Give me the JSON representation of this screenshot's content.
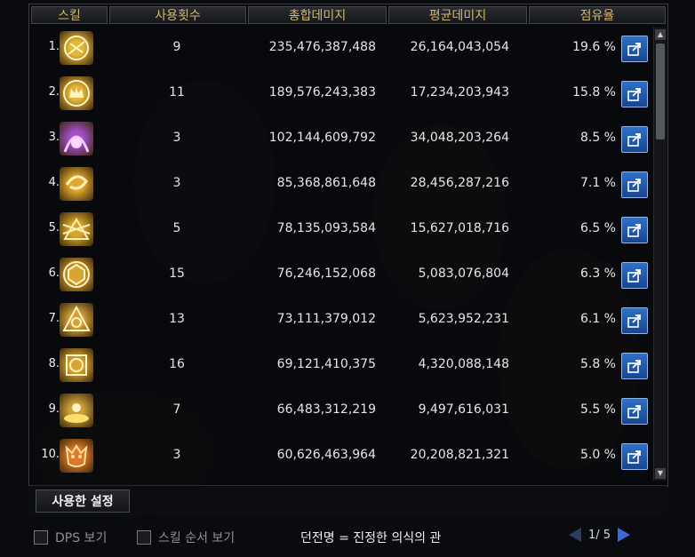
{
  "header": {
    "skill": "스킬",
    "uses": "사용횟수",
    "total": "총합데미지",
    "average": "평균데미지",
    "share": "점유율"
  },
  "rows": [
    {
      "rank": "1.",
      "icon": "skill-icon-rune-circle",
      "uses": "9",
      "total": "235,476,387,488",
      "average": "26,164,043,054",
      "share": "19.6 %",
      "color": "#e2b83a"
    },
    {
      "rank": "2.",
      "icon": "skill-icon-crown",
      "uses": "11",
      "total": "189,576,243,383",
      "average": "17,234,203,943",
      "share": "15.8 %",
      "color": "#e3b23a"
    },
    {
      "rank": "3.",
      "icon": "skill-icon-purple-aura",
      "uses": "3",
      "total": "102,144,609,792",
      "average": "34,048,203,264",
      "share": "8.5 %",
      "color": "#a24fc7"
    },
    {
      "rank": "4.",
      "icon": "skill-icon-swirl",
      "uses": "3",
      "total": "85,368,861,648",
      "average": "28,456,287,216",
      "share": "7.1 %",
      "color": "#e0a82e"
    },
    {
      "rank": "5.",
      "icon": "skill-icon-burst",
      "uses": "5",
      "total": "78,135,093,584",
      "average": "15,627,018,716",
      "share": "6.5 %",
      "color": "#d6a529"
    },
    {
      "rank": "6.",
      "icon": "skill-icon-hex-rune",
      "uses": "15",
      "total": "76,246,152,068",
      "average": "5,083,076,804",
      "share": "6.3 %",
      "color": "#d9a431"
    },
    {
      "rank": "7.",
      "icon": "skill-icon-triangle-rune",
      "uses": "13",
      "total": "73,111,379,012",
      "average": "5,623,952,231",
      "share": "6.1 %",
      "color": "#d4a23a"
    },
    {
      "rank": "8.",
      "icon": "skill-icon-square-rune",
      "uses": "16",
      "total": "69,121,410,375",
      "average": "4,320,088,148",
      "share": "5.8 %",
      "color": "#d8a434"
    },
    {
      "rank": "9.",
      "icon": "skill-icon-gold-pile",
      "uses": "7",
      "total": "66,483,312,219",
      "average": "9,497,616,031",
      "share": "5.5 %",
      "color": "#caa03a"
    },
    {
      "rank": "10.",
      "icon": "skill-icon-demon-face",
      "uses": "3",
      "total": "60,626,463,964",
      "average": "20,208,821,321",
      "share": "5.0 %",
      "color": "#e07a2a"
    }
  ],
  "tab": "사용한 설정",
  "bottom": {
    "dps_label": "DPS 보기",
    "order_label": "스킬 순서 보기",
    "dungeon": "던전명 = 진정한 의식의 관",
    "page": "1/ 5"
  },
  "colors": {
    "header_text": "#d2b66a",
    "export_button": "#2f70c7",
    "pager_next": "#3d6ad6"
  }
}
